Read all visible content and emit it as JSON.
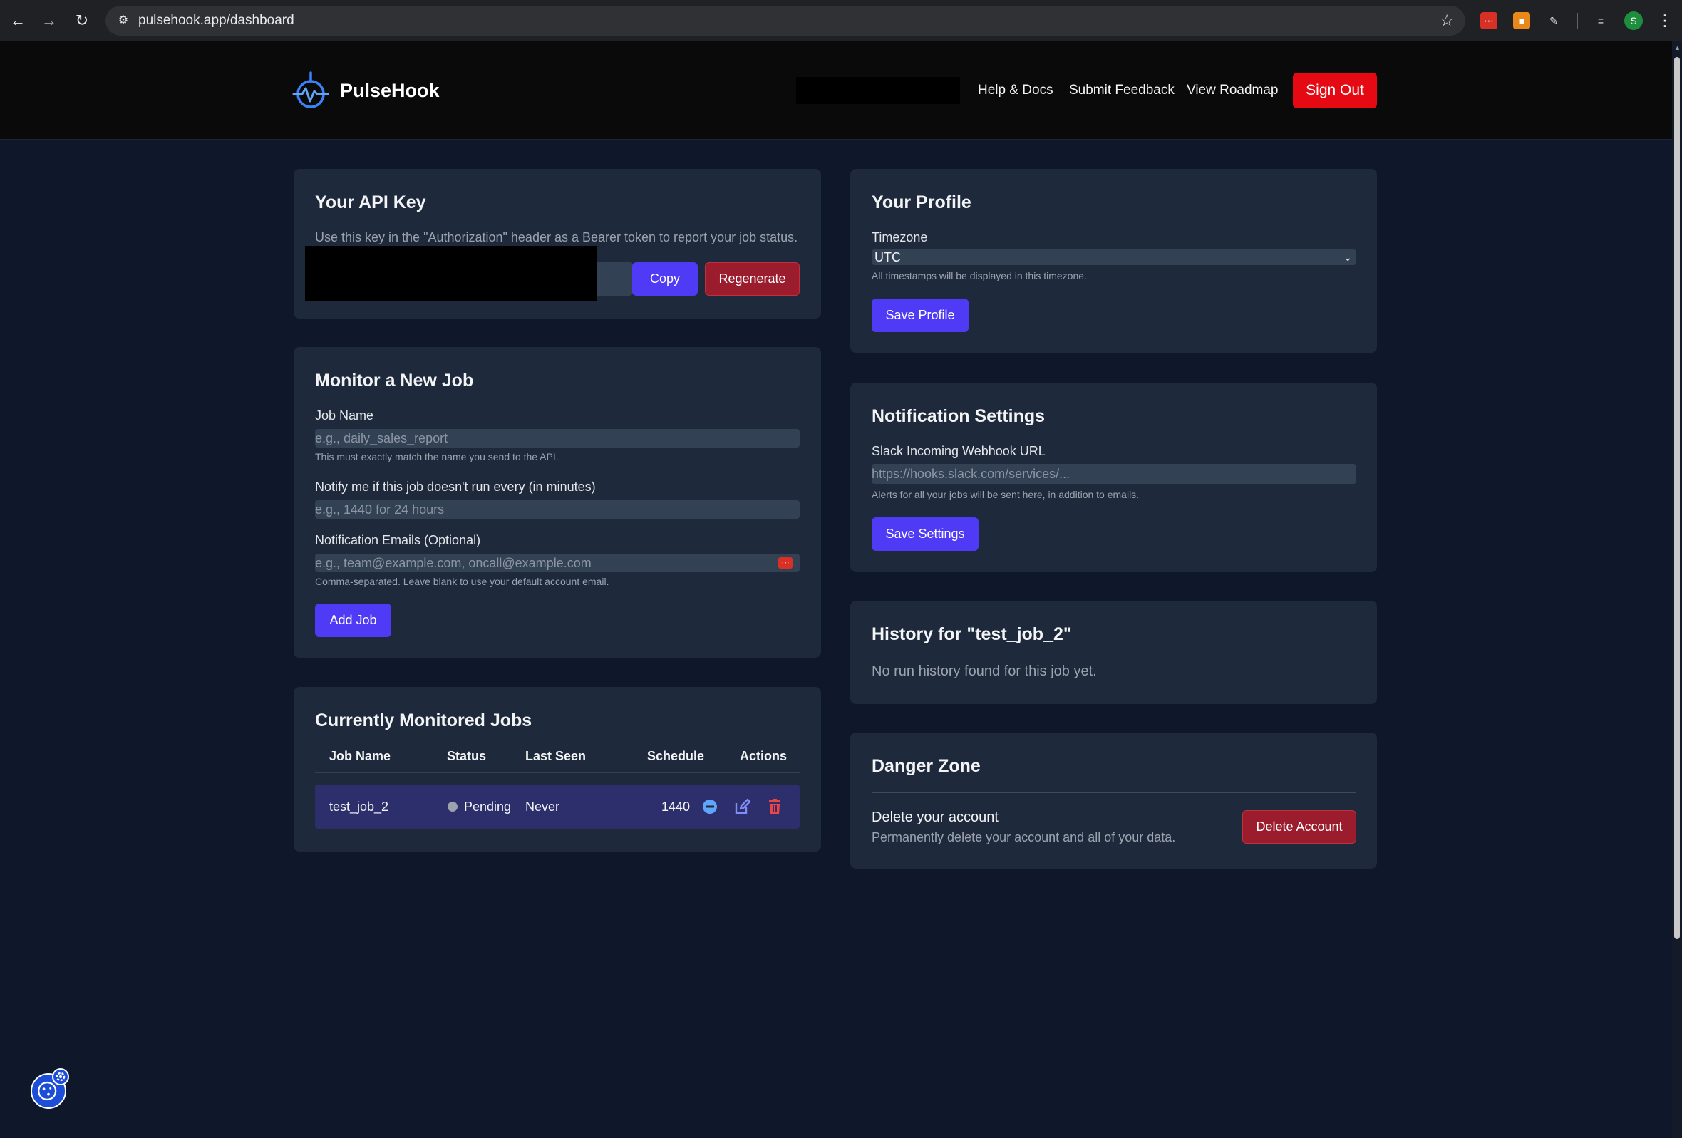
{
  "browser": {
    "url": "pulsehook.app/dashboard"
  },
  "header": {
    "brand": "PulseHook",
    "nav": [
      "Help & Docs",
      "Submit Feedback",
      "View Roadmap"
    ],
    "sign_out": "Sign Out"
  },
  "api_key": {
    "title": "Your API Key",
    "description": "Use this key in the \"Authorization\" header as a Bearer token to report your job status.",
    "copy": "Copy",
    "regenerate": "Regenerate"
  },
  "new_job": {
    "title": "Monitor a New Job",
    "job_name_label": "Job Name",
    "job_name_placeholder": "e.g., daily_sales_report",
    "job_name_hint": "This must exactly match the name you send to the API.",
    "interval_label": "Notify me if this job doesn't run every (in minutes)",
    "interval_placeholder": "e.g., 1440 for 24 hours",
    "emails_label": "Notification Emails (Optional)",
    "emails_placeholder": "e.g., team@example.com, oncall@example.com",
    "emails_hint": "Comma-separated. Leave blank to use your default account email.",
    "add_button": "Add Job"
  },
  "jobs": {
    "title": "Currently Monitored Jobs",
    "columns": [
      "Job Name",
      "Status",
      "Last Seen",
      "Schedule",
      "Actions"
    ],
    "rows": [
      {
        "name": "test_job_2",
        "status": "Pending",
        "last_seen": "Never",
        "schedule": "1440"
      }
    ]
  },
  "profile": {
    "title": "Your Profile",
    "timezone_label": "Timezone",
    "timezone_value": "UTC",
    "timezone_hint": "All timestamps will be displayed in this timezone.",
    "save_button": "Save Profile"
  },
  "notifications": {
    "title": "Notification Settings",
    "slack_label": "Slack Incoming Webhook URL",
    "slack_placeholder": "https://hooks.slack.com/services/...",
    "slack_hint": "Alerts for all your jobs will be sent here, in addition to emails.",
    "save_button": "Save Settings"
  },
  "history": {
    "title": "History for \"test_job_2\"",
    "empty": "No run history found for this job yet."
  },
  "danger": {
    "title": "Danger Zone",
    "heading": "Delete your account",
    "description": "Permanently delete your account and all of your data.",
    "delete_button": "Delete Account"
  },
  "colors": {
    "brand_accent": "#4f3bf5",
    "sign_out": "#e50914",
    "danger": "#9b1c2c",
    "card_bg": "#1e293b",
    "page_bg": "#0f172a"
  }
}
